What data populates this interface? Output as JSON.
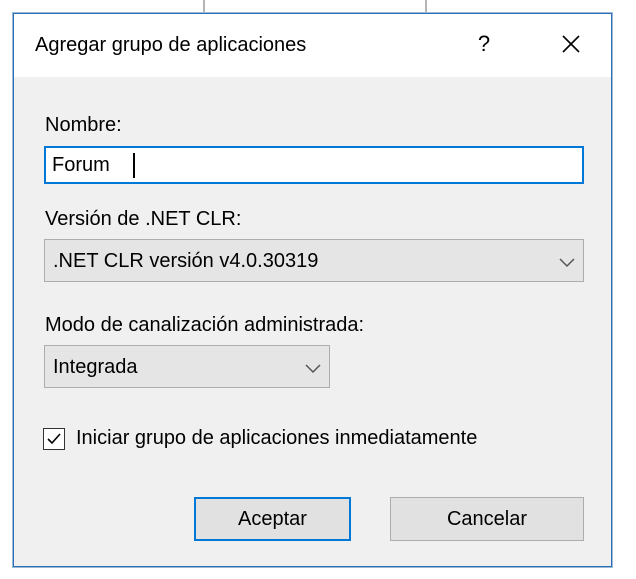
{
  "dialog": {
    "title": "Agregar grupo de aplicaciones",
    "help_label": "?",
    "close_icon": "close-icon"
  },
  "name_field": {
    "label": "Nombre:",
    "value": "Forum"
  },
  "clr_version": {
    "label": "Versión de .NET CLR:",
    "selected": ".NET CLR versión v4.0.30319",
    "icon": "chevron-down-icon"
  },
  "pipeline_mode": {
    "label": "Modo de canalización administrada:",
    "selected": "Integrada",
    "icon": "chevron-down-icon"
  },
  "start_immediately": {
    "label": "Iniciar grupo de aplicaciones inmediatamente",
    "checked": true,
    "icon": "checkmark-icon"
  },
  "buttons": {
    "ok_label": "Aceptar",
    "cancel_label": "Cancelar"
  },
  "colors": {
    "accent": "#0078d7",
    "dialog_bg": "#f0f0f0",
    "control_bg": "#e1e1e1"
  }
}
